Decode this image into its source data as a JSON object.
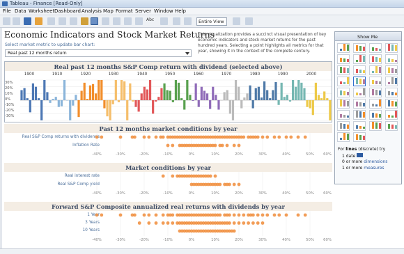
{
  "window": {
    "title": "Tableau - Finance [Read-Only]"
  },
  "menu": [
    "File",
    "Data",
    "Worksheet",
    "Dashboard",
    "Analysis",
    "Map",
    "Format",
    "Server",
    "Window",
    "Help"
  ],
  "toolbar": {
    "fit_label": "Entire View"
  },
  "dashboard": {
    "title": "Economic Indicators and Stock Market Returns",
    "description": "This visualization provides a succinct visual presentation of key economic indicators and stock market returns for the past hundred years. Selecting a point highlights all metrics for that year, showing it in the context of the complete century.",
    "metric_label": "Select market metric to update bar chart:",
    "metric_value": "Real past 12 months return"
  },
  "bar_chart": {
    "title": "Real past 12 months S&P Comp return with dividend (selected above)",
    "decades": [
      "1900",
      "1910",
      "1920",
      "1930",
      "1940",
      "1950",
      "1960",
      "1970",
      "1980",
      "1990",
      "2000"
    ],
    "y_ticks": [
      "30%",
      "20%",
      "10%",
      "0%",
      "-10%",
      "-20%",
      "-30%"
    ],
    "colors": [
      "#4d78b4",
      "#8bb5da",
      "#f28e2b",
      "#f5be6b",
      "#e25759",
      "#59a14f",
      "#8f6bb8",
      "#bbbbbb",
      "#4e79a7",
      "#76b7b2",
      "#edc948"
    ]
  },
  "chart_data": {
    "type": "bar",
    "x": [
      1900,
      1901,
      1902,
      1903,
      1904,
      1905,
      1906,
      1907,
      1908,
      1909,
      1910,
      1911,
      1912,
      1913,
      1914,
      1915,
      1916,
      1917,
      1918,
      1919,
      1920,
      1921,
      1922,
      1923,
      1924,
      1925,
      1926,
      1927,
      1928,
      1929,
      1930,
      1931,
      1932,
      1933,
      1934,
      1935,
      1936,
      1937,
      1938,
      1939,
      1940,
      1941,
      1942,
      1943,
      1944,
      1945,
      1946,
      1947,
      1948,
      1949,
      1950,
      1951,
      1952,
      1953,
      1954,
      1955,
      1956,
      1957,
      1958,
      1959,
      1960,
      1961,
      1962,
      1963,
      1964,
      1965,
      1966,
      1967,
      1968,
      1969,
      1970,
      1971,
      1972,
      1973,
      1974,
      1975,
      1976,
      1977,
      1978,
      1979,
      1980,
      1981,
      1982,
      1983,
      1984,
      1985,
      1986,
      1987,
      1988,
      1989,
      1990,
      1991,
      1992,
      1993,
      1994,
      1995,
      1996,
      1997,
      1998,
      1999,
      2000,
      2001,
      2002,
      2003,
      2004,
      2005,
      2006,
      2007,
      2008
    ],
    "values": [
      15,
      18,
      3,
      -18,
      25,
      20,
      3,
      -30,
      35,
      12,
      -4,
      2,
      5,
      -10,
      -9,
      30,
      0,
      -35,
      -8,
      8,
      -25,
      14,
      26,
      2,
      22,
      24,
      10,
      30,
      37,
      -12,
      -24,
      -40,
      -6,
      48,
      -3,
      40,
      28,
      -35,
      25,
      -2,
      -10,
      -17,
      10,
      20,
      16,
      32,
      -20,
      -2,
      5,
      18,
      25,
      15,
      14,
      -3,
      45,
      26,
      3,
      -14,
      40,
      8,
      -1,
      25,
      -10,
      20,
      14,
      10,
      -13,
      20,
      8,
      -14,
      0,
      12,
      15,
      -20,
      -32,
      30,
      20,
      -12,
      4,
      10,
      22,
      -12,
      18,
      20,
      4,
      28,
      15,
      3,
      15,
      27,
      -7,
      26,
      5,
      8,
      -2,
      34,
      20,
      30,
      26,
      18,
      -10,
      -12,
      -22,
      26,
      8,
      3,
      13,
      3,
      -37
    ],
    "ylim": [
      -30,
      30
    ]
  },
  "strips": [
    {
      "title": "Past 12 months market conditions by year",
      "rows": [
        "Real S&P Comp returns with dividends",
        "Inflation Rate"
      ]
    },
    {
      "title": "Market conditions by year",
      "rows": [
        "Real interest rate",
        "Real S&P Comp yield"
      ]
    },
    {
      "title": "Forward S&P Composite annualized real returns with dividends by year",
      "rows": [
        "1 Year",
        "3 Years",
        "10 Years"
      ]
    }
  ],
  "strip_axis": [
    "-40%",
    "-30%",
    "-20%",
    "-10%",
    "0%",
    "10%",
    "20%",
    "30%",
    "40%",
    "50%",
    "60%"
  ],
  "strip_dots": [
    [
      -40,
      -38,
      -30,
      -25,
      -24,
      -20,
      -18,
      -15,
      -13,
      -12,
      -10,
      -9,
      -8,
      -7,
      -6,
      -5,
      -4,
      -3,
      -2,
      -1,
      0,
      1,
      2,
      3,
      4,
      5,
      6,
      7,
      8,
      9,
      10,
      11,
      12,
      13,
      14,
      15,
      16,
      17,
      18,
      19,
      20,
      21,
      22,
      24,
      25,
      26,
      27,
      28,
      30,
      32,
      35,
      37,
      40,
      42,
      45,
      48
    ],
    [
      -10,
      -8,
      -5,
      -4,
      -3,
      -2,
      -1,
      0,
      1,
      2,
      3,
      4,
      5,
      6,
      7,
      8,
      9,
      10,
      12,
      13,
      15,
      18,
      20
    ],
    [
      -12,
      -8,
      -6,
      -5,
      -4,
      -3,
      -2,
      -1,
      0,
      1,
      2,
      3,
      4,
      5,
      6,
      7,
      8,
      10
    ],
    [
      0,
      1,
      2,
      3,
      4,
      5,
      6,
      7,
      8,
      9,
      10,
      11,
      12,
      14,
      15,
      16,
      18,
      20
    ],
    [
      -40,
      -38,
      -30,
      -25,
      -24,
      -20,
      -18,
      -15,
      -12,
      -10,
      -9,
      -8,
      -6,
      -5,
      -4,
      -3,
      -2,
      -1,
      0,
      1,
      2,
      3,
      4,
      5,
      6,
      7,
      8,
      9,
      10,
      11,
      12,
      14,
      15,
      16,
      18,
      20,
      22,
      24,
      25,
      26,
      28,
      30,
      32,
      35,
      37,
      40,
      45,
      48
    ],
    [
      -22,
      -18,
      -15,
      -12,
      -10,
      -8,
      -6,
      -5,
      -4,
      -3,
      -2,
      -1,
      0,
      1,
      2,
      3,
      4,
      5,
      6,
      7,
      8,
      9,
      10,
      11,
      12,
      13,
      14,
      15,
      16,
      18,
      20,
      22,
      24,
      26,
      28,
      30
    ],
    [
      -5,
      -4,
      -3,
      -2,
      -1,
      0,
      1,
      2,
      3,
      4,
      5,
      6,
      7,
      8,
      9,
      10,
      11,
      12,
      13,
      14,
      15,
      16,
      17,
      18
    ]
  ],
  "dot_color": "#f08c3a",
  "showme": {
    "title": "Show Me",
    "hint_prefix": "For ",
    "hint_mark": "lines",
    "hint_suffix": " (discrete) try",
    "req1": "1 date",
    "req2_prefix": "0 or more ",
    "req2_word": "dimensions",
    "req3_prefix": "1 or more ",
    "req3_word": "measures"
  }
}
